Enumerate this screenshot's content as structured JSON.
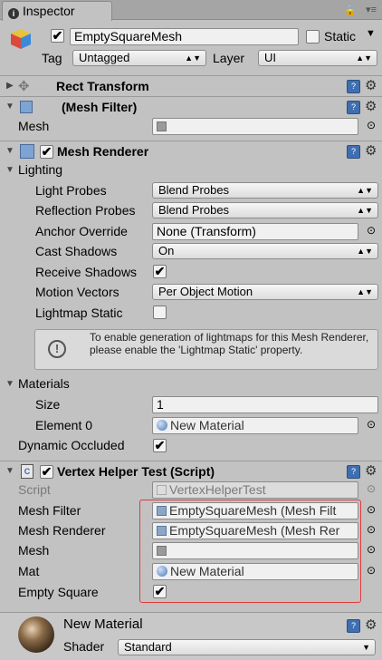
{
  "tab": {
    "title": "Inspector"
  },
  "header": {
    "name": "EmptySquareMesh",
    "static_label": "Static",
    "tag_label": "Tag",
    "tag_value": "Untagged",
    "layer_label": "Layer",
    "layer_value": "UI"
  },
  "rect_transform": {
    "title": "Rect Transform"
  },
  "mesh_filter": {
    "title": "(Mesh Filter)",
    "mesh_label": "Mesh"
  },
  "mesh_renderer": {
    "title": "Mesh Renderer",
    "lighting_label": "Lighting",
    "light_probes_label": "Light Probes",
    "light_probes_value": "Blend Probes",
    "reflection_probes_label": "Reflection Probes",
    "reflection_probes_value": "Blend Probes",
    "anchor_override_label": "Anchor Override",
    "anchor_override_value": "None (Transform)",
    "cast_shadows_label": "Cast Shadows",
    "cast_shadows_value": "On",
    "receive_shadows_label": "Receive Shadows",
    "motion_vectors_label": "Motion Vectors",
    "motion_vectors_value": "Per Object Motion",
    "lightmap_static_label": "Lightmap Static",
    "help_text": "To enable generation of lightmaps for this Mesh Renderer, please enable the 'Lightmap Static' property.",
    "materials_label": "Materials",
    "size_label": "Size",
    "size_value": "1",
    "element0_label": "Element 0",
    "element0_value": "New Material",
    "dynamic_occluded_label": "Dynamic Occluded"
  },
  "vertex_helper": {
    "title": "Vertex Helper Test (Script)",
    "script_label": "Script",
    "script_value": "VertexHelperTest",
    "mesh_filter_label": "Mesh Filter",
    "mesh_filter_value": "EmptySquareMesh (Mesh Filt",
    "mesh_renderer_label": "Mesh Renderer",
    "mesh_renderer_value": "EmptySquareMesh (Mesh Rer",
    "mesh_label": "Mesh",
    "mat_label": "Mat",
    "mat_value": "New Material",
    "empty_square_label": "Empty Square"
  },
  "material": {
    "name": "New Material",
    "shader_label": "Shader",
    "shader_value": "Standard"
  },
  "checkmark": "✔"
}
